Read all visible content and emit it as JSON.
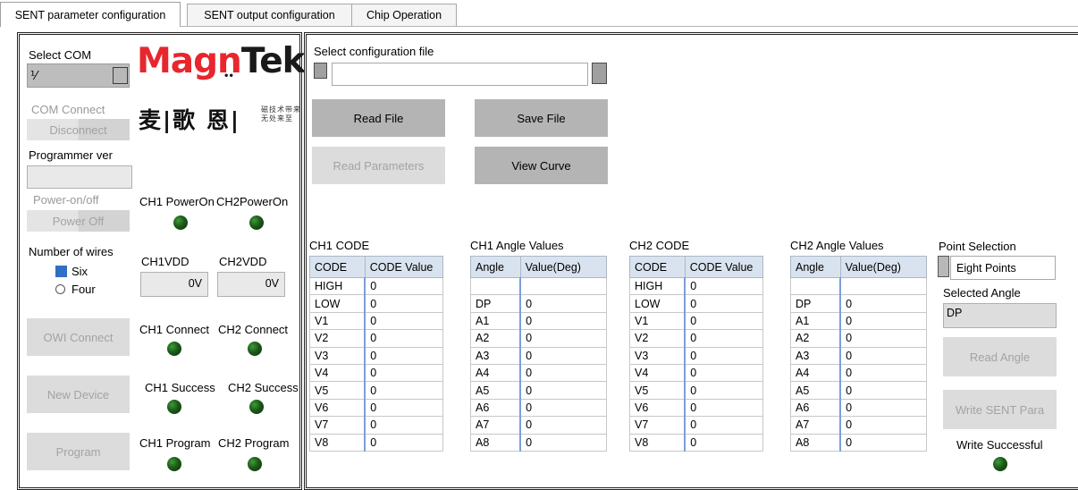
{
  "tabs": [
    "SENT parameter configuration",
    "SENT output configuration",
    "Chip Operation"
  ],
  "left": {
    "select_com_label": "Select COM",
    "com_value": "⅟",
    "com_connect_label": "COM Connect",
    "disconnect_label": "Disconnect",
    "programmer_ver_label": "Programmer ver",
    "power_label": "Power-on/off",
    "power_off_label": "Power Off",
    "ch1_poweron": "CH1 PowerOn",
    "ch2_poweron": "CH2PowerOn",
    "wires_label": "Number of wires",
    "wire_six": "Six",
    "wire_four": "Four",
    "ch1vdd_label": "CH1VDD",
    "ch2vdd_label": "CH2VDD",
    "ch1vdd_value": "0V",
    "ch2vdd_value": "0V",
    "owi_connect": "OWI Connect",
    "ch1_connect": "CH1 Connect",
    "ch2_connect": "CH2 Connect",
    "new_device": "New Device",
    "ch1_success": "CH1 Success",
    "ch2_success": "CH2 Success",
    "program": "Program",
    "ch1_program": "CH1 Program",
    "ch2_program": "CH2 Program"
  },
  "logo": {
    "text": "MagnTek",
    "chinese": "麦|歌 恩|",
    "slogan_line1": "磁技术带来",
    "slogan_line2": "无处来至"
  },
  "right": {
    "select_config_label": "Select configuration file",
    "config_file_value": "",
    "read_file": "Read File",
    "save_file": "Save File",
    "read_parameters": "Read Parameters",
    "view_curve": "View Curve"
  },
  "ch1_code": {
    "title": "CH1 CODE",
    "headers": [
      "CODE",
      "CODE Value"
    ],
    "rows": [
      [
        "HIGH",
        "0"
      ],
      [
        "LOW",
        "0"
      ],
      [
        "V1",
        "0"
      ],
      [
        "V2",
        "0"
      ],
      [
        "V3",
        "0"
      ],
      [
        "V4",
        "0"
      ],
      [
        "V5",
        "0"
      ],
      [
        "V6",
        "0"
      ],
      [
        "V7",
        "0"
      ],
      [
        "V8",
        "0"
      ]
    ]
  },
  "ch1_angle": {
    "title": "CH1 Angle Values",
    "headers": [
      "Angle",
      "Value(Deg)"
    ],
    "rows": [
      [
        "",
        ""
      ],
      [
        "DP",
        "0"
      ],
      [
        "A1",
        "0"
      ],
      [
        "A2",
        "0"
      ],
      [
        "A3",
        "0"
      ],
      [
        "A4",
        "0"
      ],
      [
        "A5",
        "0"
      ],
      [
        "A6",
        "0"
      ],
      [
        "A7",
        "0"
      ],
      [
        "A8",
        "0"
      ]
    ]
  },
  "ch2_code": {
    "title": "CH2 CODE",
    "headers": [
      "CODE",
      "CODE Value"
    ],
    "rows": [
      [
        "HIGH",
        "0"
      ],
      [
        "LOW",
        "0"
      ],
      [
        "V1",
        "0"
      ],
      [
        "V2",
        "0"
      ],
      [
        "V3",
        "0"
      ],
      [
        "V4",
        "0"
      ],
      [
        "V5",
        "0"
      ],
      [
        "V6",
        "0"
      ],
      [
        "V7",
        "0"
      ],
      [
        "V8",
        "0"
      ]
    ]
  },
  "ch2_angle": {
    "title": "CH2 Angle Values",
    "headers": [
      "Angle",
      "Value(Deg)"
    ],
    "rows": [
      [
        "",
        ""
      ],
      [
        "DP",
        "0"
      ],
      [
        "A1",
        "0"
      ],
      [
        "A2",
        "0"
      ],
      [
        "A3",
        "0"
      ],
      [
        "A4",
        "0"
      ],
      [
        "A5",
        "0"
      ],
      [
        "A6",
        "0"
      ],
      [
        "A7",
        "0"
      ],
      [
        "A8",
        "0"
      ]
    ]
  },
  "point": {
    "selection_label": "Point Selection",
    "selection_value": "Eight Points",
    "selected_angle_label": "Selected Angle",
    "selected_angle_value": "DP",
    "read_angle": "Read  Angle",
    "write_sent": "Write SENT Para",
    "write_successful": "Write Successful"
  },
  "colors": {
    "button_dark": "#b4b4b4",
    "button_disabled": "#dcdcdc",
    "table_header": "#d9e3ef",
    "led": "#1b5a18"
  }
}
